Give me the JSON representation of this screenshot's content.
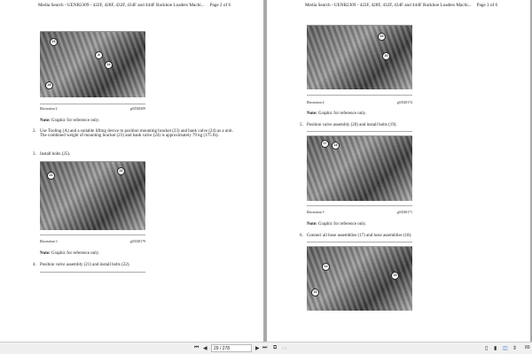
{
  "pages": [
    {
      "header": "Media Search - UENR2309 - 422F, 428F, 432F, 434F and 444F Backhoe Loaders Machi...",
      "page_label": "Page 2 of 6",
      "illustrations": [
        {
          "caption": "Illustration 2",
          "id": "g03528209",
          "callouts": [
            "23",
            "A",
            "24",
            "25"
          ]
        },
        {
          "caption": "Illustration 3",
          "id": "g03528179",
          "callouts": [
            "21",
            "22"
          ]
        }
      ],
      "note_label": "Note:",
      "note_text": " Graphic for reference only.",
      "steps": [
        {
          "num": "2.",
          "text": "Use Tooling (A) and a suitable lifting device to position mounting bracket (23) and bank valve (24) as a unit. The combined weight of mounting bracket (23) and bank valve (24) is approximately 79 kg (175 lb)."
        },
        {
          "num": "3.",
          "text": "Install bolts (25)."
        },
        {
          "num": "4.",
          "text": "Position valve assembly (21) and install bolts (22)."
        }
      ]
    },
    {
      "header": "Media Search - UENR2309 - 422F, 428F, 432F, 434F and 444F Backhoe Loaders Machi...",
      "page_label": "Page 3 of 6",
      "illustrations": [
        {
          "caption": "Illustration 4",
          "id": "g03528174",
          "callouts": [
            "19",
            "20"
          ]
        },
        {
          "caption": "Illustration 5",
          "id": "g03528171",
          "callouts": [
            "17",
            "18"
          ]
        },
        {
          "caption": "",
          "id": "",
          "callouts": [
            "14",
            "15",
            "16"
          ]
        }
      ],
      "note_label": "Note:",
      "note_text": " Graphic for reference only.",
      "steps": [
        {
          "num": "5.",
          "text": "Position valve assembly (20) and install bolts (19)."
        },
        {
          "num": "6.",
          "text": "Connect all hose assemblies (17) and hose assemblies (18)."
        }
      ]
    }
  ],
  "toolbar": {
    "page_input": "29 / 278",
    "zoom": "89"
  }
}
